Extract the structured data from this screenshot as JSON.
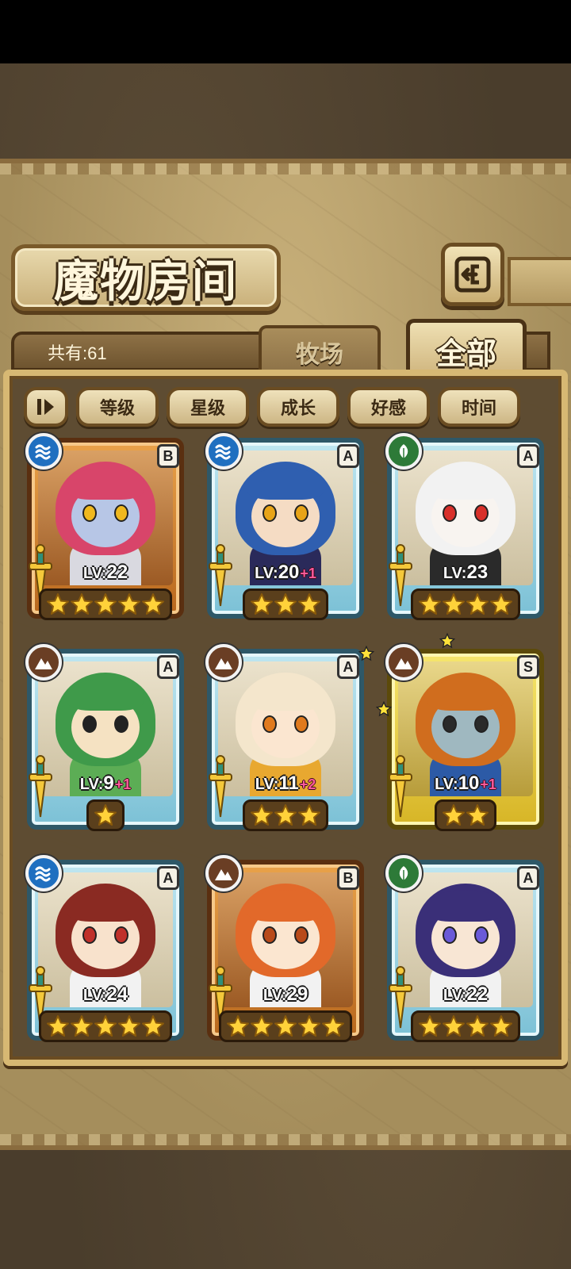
{
  "header": {
    "title": "魔物房间",
    "back_icon": "back-arrow-icon"
  },
  "tabs": {
    "count_text": "共有:61",
    "farm_label": "牧场",
    "all_label": "全部",
    "active": "全部"
  },
  "sort": {
    "toggle_icon": "sort-order-icon",
    "buttons": [
      "等级",
      "星级",
      "成长",
      "好感",
      "时间"
    ]
  },
  "colors": {
    "parchment": "#c8b07a",
    "panel_border": "#d7b873",
    "rank_A": "#7cc1d6",
    "rank_B": "#b8681e",
    "rank_S": "#d7b526",
    "element_water": "#1f6fc0",
    "element_grass": "#2d7a38",
    "element_earth": "#6a3e24",
    "plus_text": "#ff5a9a"
  },
  "monsters": [
    {
      "element": "water",
      "rank": "B",
      "level": "22",
      "plus": "",
      "stars": 5,
      "hair": "#d8456a",
      "skin": "#b7c6e6",
      "eye": "#f0b81e",
      "body": "#d9d9e0"
    },
    {
      "element": "water",
      "rank": "A",
      "level": "20",
      "plus": "+1",
      "stars": 3,
      "hair": "#2f5fb0",
      "skin": "#f5dcc4",
      "eye": "#e8a418",
      "body": "#2a2a5a"
    },
    {
      "element": "grass",
      "rank": "A",
      "level": "23",
      "plus": "",
      "stars": 4,
      "hair": "#f2f2f2",
      "skin": "#f8f4f0",
      "eye": "#d8302a",
      "body": "#2a2a2a"
    },
    {
      "element": "earth",
      "rank": "A",
      "level": "9",
      "plus": "+1",
      "stars": 1,
      "hair": "#3f9a4a",
      "skin": "#f5e2c2",
      "eye": "#222222",
      "body": "#5cad55"
    },
    {
      "element": "earth",
      "rank": "A",
      "level": "11",
      "plus": "+2",
      "stars": 3,
      "hair": "#f4e6cc",
      "skin": "#fbe6d0",
      "eye": "#e07a1e",
      "body": "#e8a830"
    },
    {
      "element": "earth",
      "rank": "S",
      "level": "10",
      "plus": "+1",
      "stars": 2,
      "hair": "#d06d1e",
      "skin": "#9fb8c0",
      "eye": "#2a2a2a",
      "body": "#2c5aa6"
    },
    {
      "element": "water",
      "rank": "A",
      "level": "24",
      "plus": "",
      "stars": 5,
      "hair": "#8a2a22",
      "skin": "#f8e2cc",
      "eye": "#c0302a",
      "body": "#f2f2f2"
    },
    {
      "element": "earth",
      "rank": "B",
      "level": "29",
      "plus": "",
      "stars": 5,
      "hair": "#e2692a",
      "skin": "#fbe6d0",
      "eye": "#b84a1a",
      "body": "#f2f2f2"
    },
    {
      "element": "grass",
      "rank": "A",
      "level": "22",
      "plus": "",
      "stars": 4,
      "hair": "#3a2f78",
      "skin": "#f8e6d4",
      "eye": "#6a5ad8",
      "body": "#f2f2f2"
    }
  ]
}
